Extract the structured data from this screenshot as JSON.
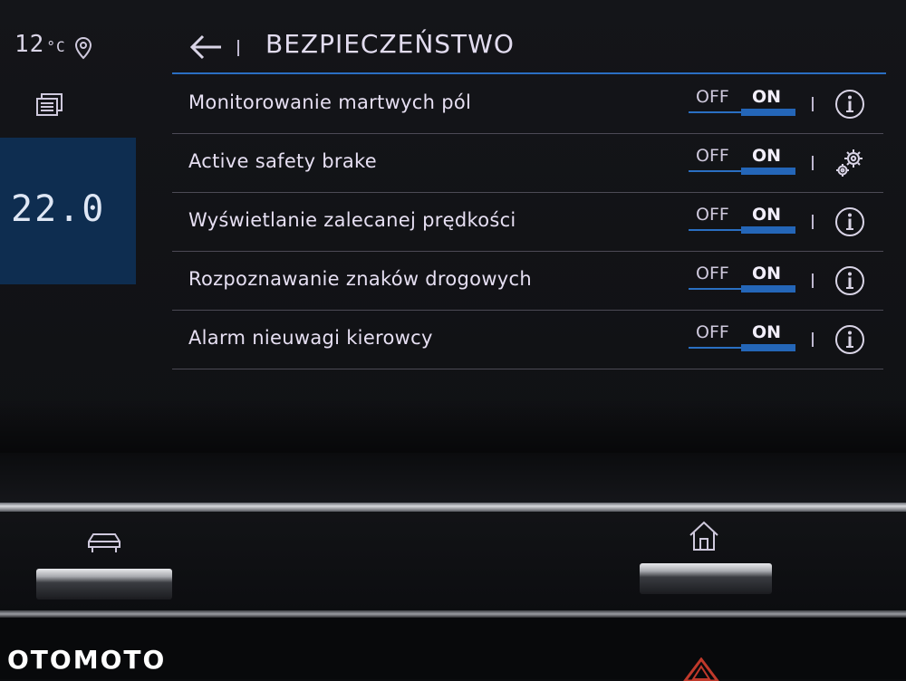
{
  "status": {
    "outside_temp": "12",
    "outside_unit": "°C",
    "climate_temp": "22.0"
  },
  "header": {
    "title": "BEZPIECZEŃSTWO"
  },
  "settings": [
    {
      "label": "Monitorowanie martwych pól",
      "off": "OFF",
      "on": "ON",
      "state": "on",
      "icon": "info-icon"
    },
    {
      "label": "Active safety brake",
      "off": "OFF",
      "on": "ON",
      "state": "on",
      "icon": "gears-icon"
    },
    {
      "label": "Wyświetlanie zalecanej prędkości",
      "off": "OFF",
      "on": "ON",
      "state": "on",
      "icon": "info-icon"
    },
    {
      "label": "Rozpoznawanie znaków drogowych",
      "off": "OFF",
      "on": "ON",
      "state": "on",
      "icon": "info-icon"
    },
    {
      "label": "Alarm nieuwagi kierowcy",
      "off": "OFF",
      "on": "ON",
      "state": "on",
      "icon": "info-icon"
    }
  ],
  "watermark": "OTOMOTO",
  "colors": {
    "accent": "#2466b8",
    "climate_box": "#0e2d50",
    "text": "#e6dff2"
  }
}
